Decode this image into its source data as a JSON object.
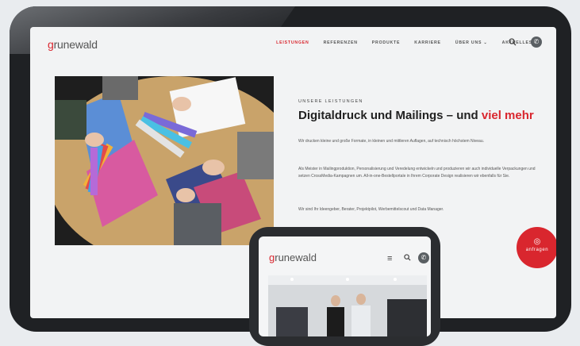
{
  "site": {
    "logo_accent": "g",
    "logo_rest": "runewald"
  },
  "nav": {
    "items": [
      "LEISTUNGEN",
      "REFERENZEN",
      "PRODUKTE",
      "KARRIERE",
      "ÜBER UNS ⌄",
      "AKTUELLES"
    ],
    "active_index": 0
  },
  "hero": {
    "eyebrow": "UNSERE LEISTUNGEN",
    "headline_main": "Digitaldruck und Mailings – und ",
    "headline_accent": "viel mehr",
    "paragraphs": [
      "Wir drucken kleine und große Formate, in kleinen und mittleren Auflagen, auf technisch höchstem Niveau.",
      "Als Meister in Mailingproduktion, Personalisierung und Veredelung entwickeln und produzieren wir auch individuelle Verpackungen und setzen CrossMedia-Kampagnen um. All-in-one-Bestellportale in Ihrem Corporate Design realisieren wir ebenfalls für Sie.",
      "Wir sind Ihr Ideengeber, Berater, Projektpilot, Werbemittelscout und Data Manager."
    ]
  },
  "cta": {
    "label": "anfragen"
  },
  "colors": {
    "brand_red": "#d9262e",
    "device_frame": "#1f2124"
  },
  "icons": [
    "search-icon",
    "phone-icon",
    "menu-icon",
    "chat-icon"
  ]
}
